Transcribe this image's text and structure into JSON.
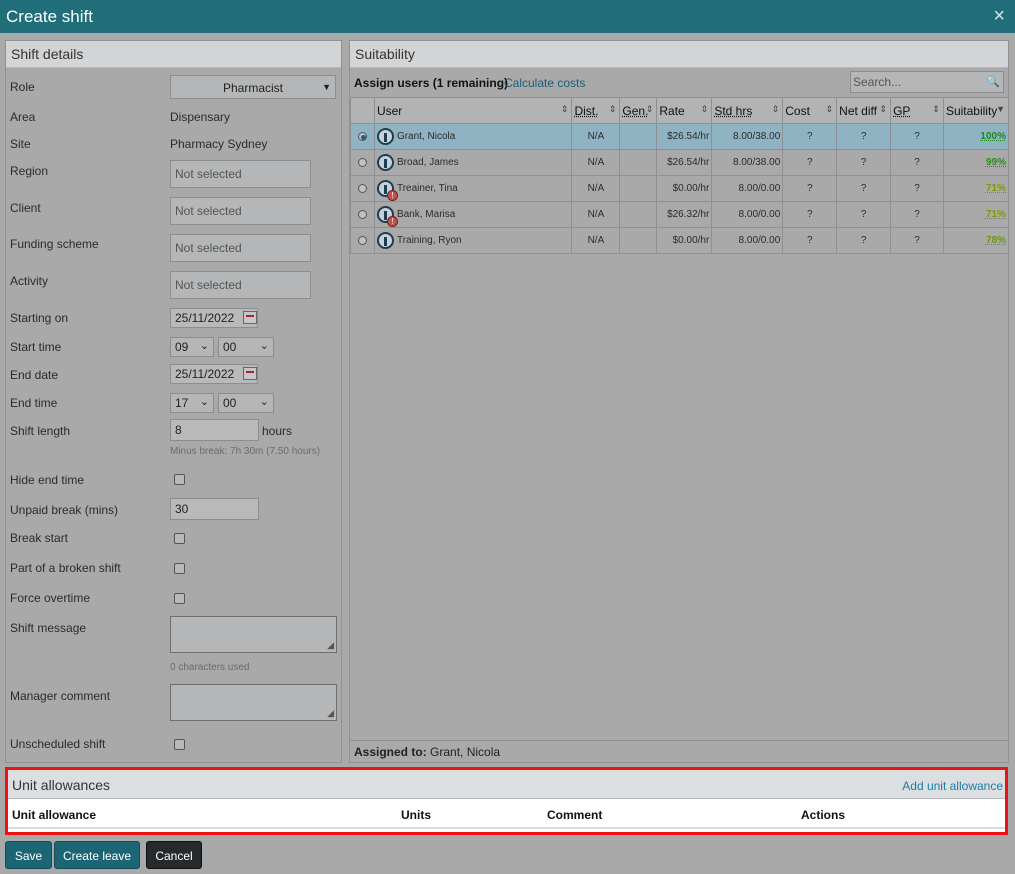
{
  "dialog": {
    "title": "Create shift",
    "close_icon": "×"
  },
  "shift_details": {
    "heading": "Shift details",
    "role": {
      "label": "Role",
      "value": "Pharmacist"
    },
    "area": {
      "label": "Area",
      "value": "Dispensary"
    },
    "site": {
      "label": "Site",
      "value": "Pharmacy Sydney"
    },
    "region": {
      "label": "Region",
      "placeholder": "Not selected"
    },
    "client": {
      "label": "Client",
      "placeholder": "Not selected"
    },
    "funding": {
      "label": "Funding scheme",
      "placeholder": "Not selected"
    },
    "activity": {
      "label": "Activity",
      "placeholder": "Not selected"
    },
    "starting_on": {
      "label": "Starting on",
      "value": "25/11/2022"
    },
    "start_time": {
      "label": "Start time",
      "hour": "09",
      "minute": "00"
    },
    "end_date": {
      "label": "End date",
      "value": "25/11/2022"
    },
    "end_time": {
      "label": "End time",
      "hour": "17",
      "minute": "00"
    },
    "shift_length": {
      "label": "Shift length",
      "value": "8",
      "unit": "hours",
      "hint": "Minus break: 7h 30m (7.50 hours)"
    },
    "hide_end_time": {
      "label": "Hide end time",
      "checked": false
    },
    "unpaid_break": {
      "label": "Unpaid break (mins)",
      "value": "30"
    },
    "break_start": {
      "label": "Break start",
      "checked": false
    },
    "broken_shift": {
      "label": "Part of a broken shift",
      "checked": false
    },
    "force_overtime": {
      "label": "Force overtime",
      "checked": false
    },
    "shift_message": {
      "label": "Shift message",
      "hint": "0 characters used"
    },
    "manager_comment": {
      "label": "Manager comment"
    },
    "unscheduled": {
      "label": "Unscheduled shift",
      "checked": false
    }
  },
  "suitability": {
    "heading": "Suitability",
    "assign_label": "Assign users (1 remaining)",
    "calc_link": "Calculate costs",
    "search_placeholder": "Search...",
    "columns": [
      "User",
      "Dist.",
      "Gen.",
      "Rate",
      "Std hrs",
      "Cost",
      "Net diff",
      "GP",
      "Suitability"
    ],
    "rows": [
      {
        "name": "Grant, Nicola",
        "dist": "N/A",
        "gen": "",
        "rate": "$26.54/hr",
        "std": "8.00/38.00",
        "cost": "?",
        "net": "?",
        "gp": "?",
        "suit": "100%",
        "suit_color": "#1c8a1c",
        "selected": true,
        "warn": false
      },
      {
        "name": "Broad, James",
        "dist": "N/A",
        "gen": "",
        "rate": "$26.54/hr",
        "std": "8.00/38.00",
        "cost": "?",
        "net": "?",
        "gp": "?",
        "suit": "99%",
        "suit_color": "#2a8f16",
        "selected": false,
        "warn": false
      },
      {
        "name": "Treainer, Tina",
        "dist": "N/A",
        "gen": "",
        "rate": "$0.00/hr",
        "std": "8.00/0.00",
        "cost": "?",
        "net": "?",
        "gp": "?",
        "suit": "71%",
        "suit_color": "#7a9a0c",
        "selected": false,
        "warn": true
      },
      {
        "name": "Bank, Marisa",
        "dist": "N/A",
        "gen": "",
        "rate": "$26.32/hr",
        "std": "8.00/0.00",
        "cost": "?",
        "net": "?",
        "gp": "?",
        "suit": "71%",
        "suit_color": "#7a9a0c",
        "selected": false,
        "warn": true
      },
      {
        "name": "Training, Ryon",
        "dist": "N/A",
        "gen": "",
        "rate": "$0.00/hr",
        "std": "8.00/0.00",
        "cost": "?",
        "net": "?",
        "gp": "?",
        "suit": "78%",
        "suit_color": "#6a9a0c",
        "selected": false,
        "warn": false
      }
    ],
    "assigned_label": "Assigned to:",
    "assigned_value": "Grant, Nicola"
  },
  "unit_allowances": {
    "heading": "Unit allowances",
    "add_link": "Add unit allowance",
    "columns": [
      "Unit allowance",
      "Units",
      "Comment",
      "Actions"
    ]
  },
  "buttons": {
    "save": "Save",
    "create_leave": "Create leave",
    "cancel": "Cancel"
  },
  "colors": {
    "titlebar": "#1f6e7a",
    "highlight_border": "#ee1111",
    "link": "#16607a"
  }
}
